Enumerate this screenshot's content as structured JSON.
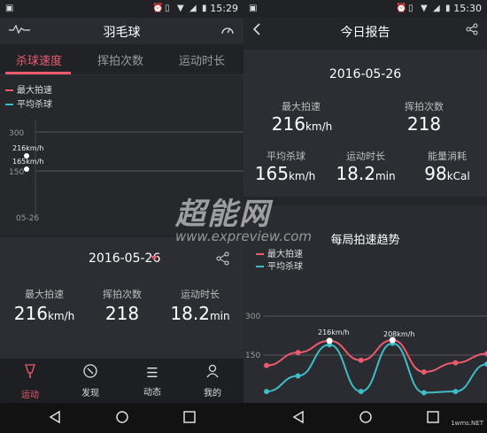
{
  "left": {
    "status": {
      "time": "15:29"
    },
    "appbar": {
      "title": "羽毛球",
      "left_icon": "waveform-icon",
      "right_icon": "speedometer-icon"
    },
    "tabs": [
      {
        "label": "杀球速度",
        "active": true
      },
      {
        "label": "挥拍次数"
      },
      {
        "label": "运动时长"
      }
    ],
    "chart": {
      "legend": [
        {
          "name": "最大拍速",
          "color": "#ec5a6e"
        },
        {
          "name": "平均杀球",
          "color": "#3fbcc6"
        }
      ],
      "y_ticks": [
        "300",
        "150"
      ],
      "x_label": "05-26",
      "points": [
        {
          "label": "216km/h",
          "value": 216
        },
        {
          "label": "165km/h",
          "value": 165
        }
      ]
    },
    "summary": {
      "date": "2016-05-26",
      "stats": [
        {
          "label": "最大拍速",
          "value": "216",
          "unit": "km/h"
        },
        {
          "label": "挥拍次数",
          "value": "218",
          "unit": ""
        },
        {
          "label": "运动时长",
          "value": "18.2",
          "unit": "min"
        }
      ]
    },
    "nav": [
      {
        "label": "运动",
        "icon": "badminton-icon",
        "active": true
      },
      {
        "label": "发现",
        "icon": "compass-icon"
      },
      {
        "label": "动态",
        "icon": "list-icon"
      },
      {
        "label": "我的",
        "icon": "person-icon"
      }
    ]
  },
  "right": {
    "status": {
      "time": "15:30"
    },
    "appbar": {
      "title": "今日报告",
      "left_icon": "back-arrow-icon",
      "right_icon": "share-icon"
    },
    "report": {
      "date": "2016-05-26",
      "stats": [
        {
          "label": "最大拍速",
          "value": "216",
          "unit": "km/h"
        },
        {
          "label": "挥拍次数",
          "value": "218",
          "unit": ""
        },
        {
          "label": "平均杀球",
          "value": "165",
          "unit": "km/h"
        },
        {
          "label": "运动时长",
          "value": "18.2",
          "unit": "min"
        },
        {
          "label": "能量消耗",
          "value": "98",
          "unit": "kCal"
        }
      ]
    },
    "trend": {
      "title": "每局拍速趋势",
      "legend": [
        {
          "name": "最大拍速",
          "color": "#ec5a6e"
        },
        {
          "name": "平均杀球",
          "color": "#3fbcc6"
        }
      ],
      "y_ticks": [
        "300",
        "150"
      ],
      "callouts": [
        "216km/h",
        "208km/h"
      ]
    }
  },
  "chart_data": {
    "type": "line",
    "title": "每局拍速趋势",
    "y_ticks": [
      150,
      300
    ],
    "ylim": [
      0,
      300
    ],
    "series": [
      {
        "name": "最大拍速",
        "color": "#ec5a6e",
        "values": [
          110,
          160,
          205,
          130,
          208,
          85,
          120,
          155
        ]
      },
      {
        "name": "平均杀球",
        "color": "#3fbcc6",
        "values": [
          10,
          70,
          190,
          10,
          195,
          5,
          10,
          115
        ]
      }
    ],
    "annotations": [
      "216km/h",
      "208km/h"
    ]
  },
  "watermark": {
    "big": "超能网",
    "small": "www.expreview.com",
    "corner": "1wms.NET"
  }
}
